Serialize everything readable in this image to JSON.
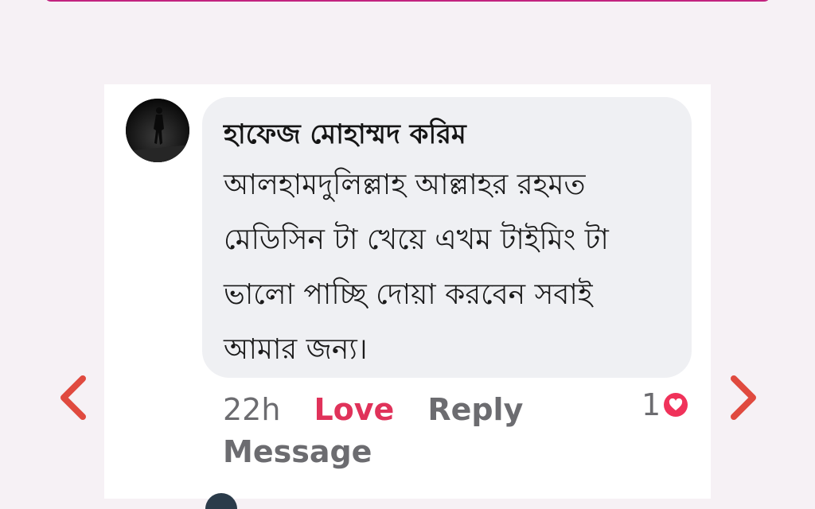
{
  "comment": {
    "author": "হাফেজ মোহাম্মদ করিম",
    "text": "আলহামদুলিল্লাহ আল্লাহর রহমত মেডিসিন টা খেয়ে এখম টাইমিং টা ভালো পাচ্ছি দোয়া করবেন সবাই আমার জন্য।",
    "time": "22h",
    "love_label": "Love",
    "reply_label": "Reply",
    "message_label": "Message",
    "reaction_count": "1",
    "reaction_icon": "heart-icon"
  },
  "navigation": {
    "prev_icon": "chevron-left-icon",
    "next_icon": "chevron-right-icon"
  },
  "colors": {
    "love": "#e0325a",
    "heart_badge": "#f0325a",
    "arrows": "#e04a3f",
    "accent_border": "#c2237f",
    "bubble": "#eff0f3"
  }
}
